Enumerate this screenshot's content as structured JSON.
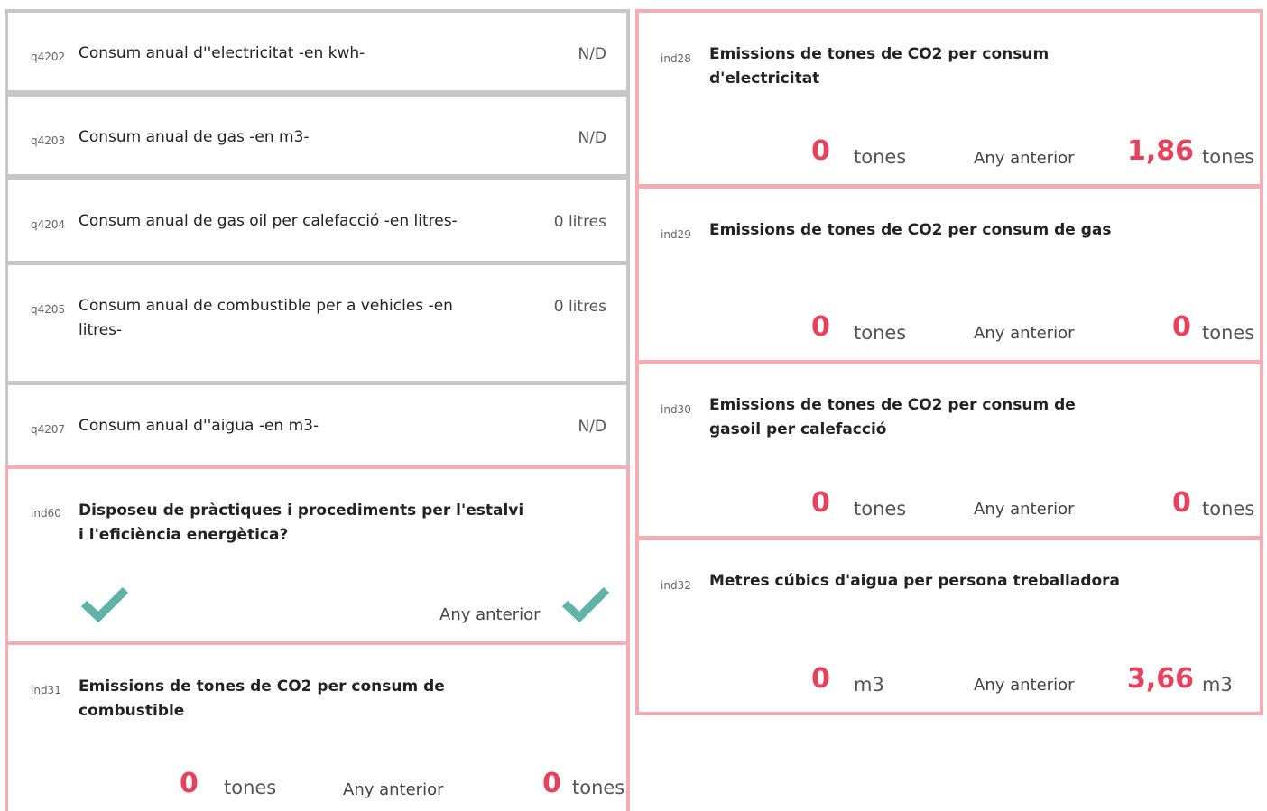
{
  "left_cards": [
    {
      "code": "q4202",
      "label": "Consum anual d''electricitat -en kwh-",
      "value": "N/D"
    },
    {
      "code": "q4203",
      "label": "Consum anual de gas -en m3-",
      "value": "N/D"
    },
    {
      "code": "q4204",
      "label": "Consum anual de gas oil per calefacció -en litres-",
      "value": "0 litres"
    },
    {
      "code": "q4205",
      "label": "Consum anual de combustible per a vehicles -en litres-",
      "value": "0 litres"
    },
    {
      "code": "q4207",
      "label": "Consum anual d''aigua -en m3-",
      "value": "N/D"
    }
  ],
  "ind60": {
    "code": "ind60",
    "label": "Disposeu de pràctiques i procediments per l'estalvi i l'eficiència energètica?",
    "current_icon": "check-icon",
    "previous_label": "Any anterior",
    "previous_icon": "check-icon"
  },
  "ind31": {
    "code": "ind31",
    "label": "Emissions de tones de CO2 per consum de combustible",
    "current_value": "0",
    "current_unit": "tones",
    "previous_label": "Any anterior",
    "previous_value": "0",
    "previous_unit": "tones"
  },
  "right_cards": [
    {
      "code": "ind28",
      "label": "Emissions de tones de CO2 per consum d'electricitat",
      "current_value": "0",
      "current_unit": "tones",
      "previous_label": "Any anterior",
      "previous_value": "1,86",
      "previous_unit": "tones"
    },
    {
      "code": "ind29",
      "label": "Emissions de tones de CO2 per consum de gas",
      "current_value": "0",
      "current_unit": "tones",
      "previous_label": "Any anterior",
      "previous_value": "0",
      "previous_unit": "tones"
    },
    {
      "code": "ind30",
      "label": "Emissions de tones de CO2 per consum de gasoil per calefacció",
      "current_value": "0",
      "current_unit": "tones",
      "previous_label": "Any anterior",
      "previous_value": "0",
      "previous_unit": "tones"
    },
    {
      "code": "ind32",
      "label": "Metres cúbics d'aigua per persona treballadora",
      "current_value": "0",
      "current_unit": "m3",
      "previous_label": "Any anterior",
      "previous_value": "3,66",
      "previous_unit": "m3"
    }
  ],
  "colors": {
    "accent": "#e8415c",
    "check": "#5fb3a8",
    "pink_border": "#f2aeb2",
    "gray_border": "#c7c7c7"
  }
}
